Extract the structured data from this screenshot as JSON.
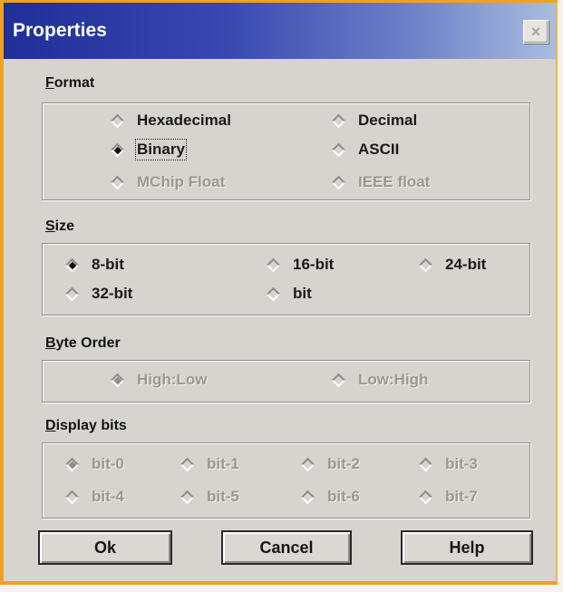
{
  "window": {
    "title": "Properties",
    "close_symbol": "×"
  },
  "format": {
    "label_prefix": "F",
    "label_rest": "ormat",
    "options": [
      {
        "label": "Hexadecimal",
        "checked": false,
        "enabled": true
      },
      {
        "label": "Decimal",
        "checked": false,
        "enabled": true
      },
      {
        "label": "Binary",
        "checked": true,
        "enabled": true
      },
      {
        "label": "ASCII",
        "checked": false,
        "enabled": true
      },
      {
        "label": "MChip Float",
        "checked": false,
        "enabled": false
      },
      {
        "label": "IEEE float",
        "checked": false,
        "enabled": false
      }
    ]
  },
  "size": {
    "label_prefix": "S",
    "label_rest": "ize",
    "options": [
      {
        "label": "8-bit",
        "checked": true,
        "enabled": true
      },
      {
        "label": "16-bit",
        "checked": false,
        "enabled": true
      },
      {
        "label": "24-bit",
        "checked": false,
        "enabled": true
      },
      {
        "label": "32-bit",
        "checked": false,
        "enabled": true
      },
      {
        "label": "bit",
        "checked": false,
        "enabled": true
      }
    ]
  },
  "byte_order": {
    "label_prefix": "B",
    "label_rest": "yte Order",
    "options": [
      {
        "label": "High:Low",
        "checked": true,
        "enabled": false
      },
      {
        "label": "Low:High",
        "checked": false,
        "enabled": false
      }
    ]
  },
  "display_bits": {
    "label_prefix": "D",
    "label_rest": "isplay bits",
    "options": [
      {
        "label": "bit-0",
        "checked": true,
        "enabled": false
      },
      {
        "label": "bit-1",
        "checked": false,
        "enabled": false
      },
      {
        "label": "bit-2",
        "checked": false,
        "enabled": false
      },
      {
        "label": "bit-3",
        "checked": false,
        "enabled": false
      },
      {
        "label": "bit-4",
        "checked": false,
        "enabled": false
      },
      {
        "label": "bit-5",
        "checked": false,
        "enabled": false
      },
      {
        "label": "bit-6",
        "checked": false,
        "enabled": false
      },
      {
        "label": "bit-7",
        "checked": false,
        "enabled": false
      }
    ]
  },
  "buttons": {
    "ok": "Ok",
    "cancel": "Cancel",
    "help": "Help"
  },
  "colors": {
    "title_bar": "#1f2f97",
    "window_border": "#f0a21d",
    "dialog_face": "#d7d4cf"
  }
}
